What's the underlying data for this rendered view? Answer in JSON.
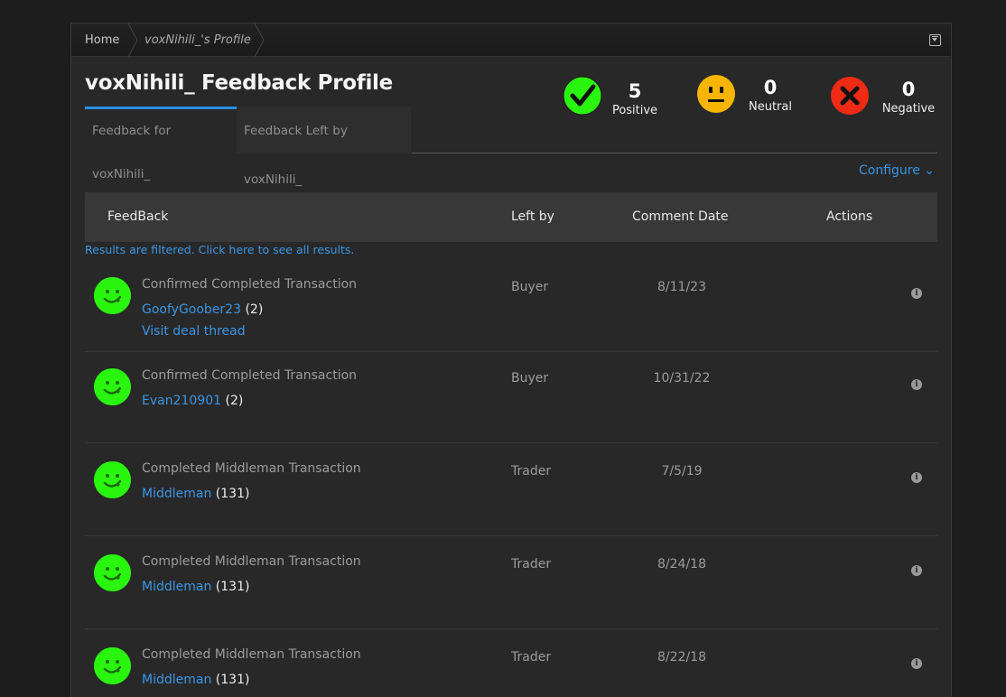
{
  "breadcrumb": {
    "home": "Home",
    "current": "voxNihili_'s Profile"
  },
  "title": "voxNihili_ Feedback Profile",
  "tabs": {
    "for": "Feedback for voxNihili_",
    "left": "Feedback Left by voxNihili_"
  },
  "stats": {
    "positive": {
      "count": "5",
      "label": "Positive",
      "color": "#2af50e"
    },
    "neutral": {
      "count": "0",
      "label": "Neutral",
      "color": "#f7b500"
    },
    "negative": {
      "count": "0",
      "label": "Negative",
      "color": "#ee2b14"
    }
  },
  "configure": "Configure ⌄",
  "table": {
    "headers": [
      "FeedBack",
      "Left by",
      "Comment Date",
      "Actions"
    ],
    "filter_note": "Results are filtered. Click here to see all results.",
    "rows": [
      {
        "type": "Confirmed Completed Transaction",
        "user": "GoofyGoober23",
        "count": "(2)",
        "deal": "Visit deal thread",
        "left_by": "Buyer",
        "date": "8/11/23"
      },
      {
        "type": "Confirmed Completed Transaction",
        "user": "Evan210901",
        "count": "(2)",
        "deal": "",
        "left_by": "Buyer",
        "date": "10/31/22"
      },
      {
        "type": "Completed Middleman Transaction",
        "user": "Middleman",
        "count": "(131)",
        "deal": "",
        "left_by": "Trader",
        "date": "7/5/19"
      },
      {
        "type": "Completed Middleman Transaction",
        "user": "Middleman",
        "count": "(131)",
        "deal": "",
        "left_by": "Trader",
        "date": "8/24/18"
      },
      {
        "type": "Completed Middleman Transaction",
        "user": "Middleman",
        "count": "(131)",
        "deal": "",
        "left_by": "Trader",
        "date": "8/22/18"
      }
    ]
  },
  "icons": {
    "row_rating": "smiley-positive-icon",
    "row_action": "info-icon"
  }
}
